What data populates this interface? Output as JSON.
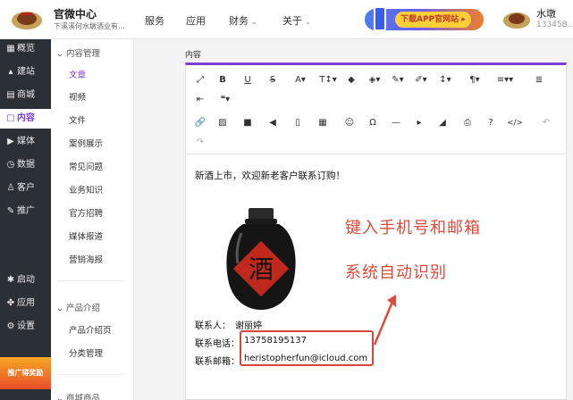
{
  "header": {
    "brand_title": "官微中心",
    "brand_subtitle": "下溪溪何水墩酒业有...",
    "nav": [
      {
        "label": "服务"
      },
      {
        "label": "应用"
      },
      {
        "label": "财务",
        "caret": "⌄"
      },
      {
        "label": "关于",
        "caret": "⌄"
      }
    ],
    "app_banner": "下载APP官网站 ▸",
    "user_name": "水墩",
    "user_phone": "13345B..."
  },
  "rail": {
    "items": [
      {
        "icon": "▦",
        "label": "概览"
      },
      {
        "icon": "▴",
        "label": "建站"
      },
      {
        "icon": "▤",
        "label": "商城"
      },
      {
        "icon": "▢",
        "label": "内容"
      },
      {
        "icon": "▶",
        "label": "媒体"
      },
      {
        "icon": "◷",
        "label": "数据"
      },
      {
        "icon": "♙",
        "label": "客户"
      },
      {
        "icon": "✎",
        "label": "推广"
      },
      {
        "icon": "✱",
        "label": "启动"
      },
      {
        "icon": "✤",
        "label": "应用"
      },
      {
        "icon": "⚙",
        "label": "设置"
      }
    ],
    "promo": "推广得奖励"
  },
  "subnav": {
    "groups": [
      {
        "label": "⌄ 内容管理"
      },
      {
        "label": "⌄ 产品介绍"
      },
      {
        "label": "⌄ 商城商品"
      }
    ],
    "items": [
      "文章",
      "视频",
      "文件",
      "案例展示",
      "常见问题",
      "业务知识",
      "官方招聘",
      "媒体报道",
      "营销海报",
      "产品介绍页",
      "分类管理"
    ]
  },
  "editor": {
    "field_label": "内容",
    "toolbar": {
      "row1": [
        "⤢",
        "B",
        "U",
        "S",
        "A▾",
        "T↕▾",
        "◆",
        "◈▾",
        "✎▾",
        "✐▾",
        "↕▾",
        "¶▾",
        "≡▾▾",
        "≣"
      ],
      "row2": [
        "⇤",
        "❝▾"
      ],
      "row3": [
        "🔗",
        "▨",
        "■",
        "◀",
        "▯",
        "▦",
        "☺",
        "Ω",
        "—",
        "▸",
        "◢",
        "⎙",
        "?",
        "</>",
        "↶"
      ],
      "row4": [
        "↷"
      ]
    },
    "content": {
      "greeting": "新酒上市，欢迎新老客户联系订购！",
      "jar_char": "酒",
      "annotation_line1": "键入手机号和邮箱",
      "annotation_line2": "系统自动识别",
      "contact_label": "联系人：",
      "contact_name": "谢丽婷",
      "phone_label": "联系电话：",
      "phone_value": "13758195137",
      "email_label": "联系邮箱：",
      "email_value": "heristopherfun@icloud.com"
    }
  },
  "colors": {
    "accent": "#7b3fd4",
    "rail_bg": "#2b2f36",
    "annotation": "#e04a3a",
    "highlight": "#d9453a"
  }
}
